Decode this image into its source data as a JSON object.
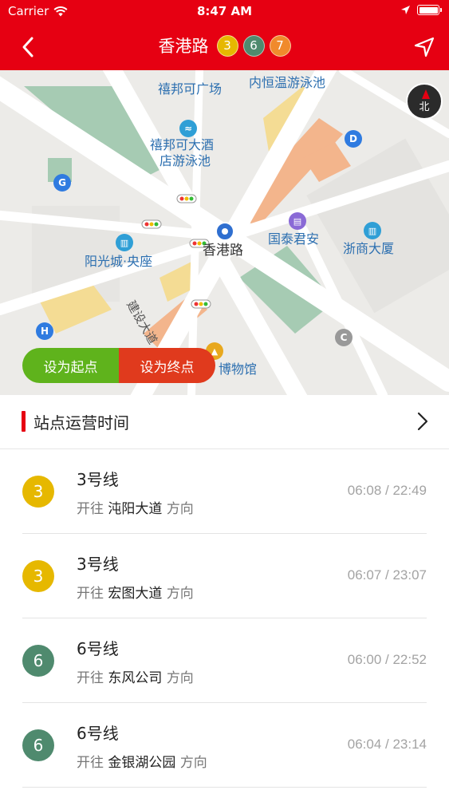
{
  "status_bar": {
    "carrier": "Carrier",
    "time": "8:47 AM"
  },
  "nav": {
    "back_icon": "chevron-left-icon",
    "title": "香港路",
    "badges": [
      {
        "label": "3",
        "color": "#e6b800"
      },
      {
        "label": "6",
        "color": "#4f8a6e"
      },
      {
        "label": "7",
        "color": "#f08a2c"
      }
    ],
    "navigate_icon": "navigation-arrow-icon"
  },
  "map": {
    "labels": {
      "yixinwen": "禧邦可广场",
      "pool_top": "内恒温游泳池",
      "hotel_pool_1": "禧邦可大酒",
      "hotel_pool_2": "店游泳池",
      "yangguang": "阳光城·央座",
      "station": "香港路",
      "guotai": "国泰君安",
      "zheshang": "浙商大厦",
      "museum": "博物馆",
      "road": "建设大道"
    },
    "compass_label": "北",
    "set_start_label": "设为起点",
    "set_end_label": "设为终点",
    "colors": {
      "background": "#ecebe8",
      "road": "#ffffff",
      "green": "#9bc4a8",
      "yellow": "#f4dc94",
      "orange": "#f3b58c"
    }
  },
  "section": {
    "title": "站点运营时间",
    "chevron_icon": "chevron-right-icon"
  },
  "lines": [
    {
      "number": "3",
      "name": "3号线",
      "prefix": "开往",
      "destination": "沌阳大道",
      "suffix": "方向",
      "times": "06:08 / 22:49",
      "color": "#e6b800"
    },
    {
      "number": "3",
      "name": "3号线",
      "prefix": "开往",
      "destination": "宏图大道",
      "suffix": "方向",
      "times": "06:07 / 23:07",
      "color": "#e6b800"
    },
    {
      "number": "6",
      "name": "6号线",
      "prefix": "开往",
      "destination": "东风公司",
      "suffix": "方向",
      "times": "06:00 / 22:52",
      "color": "#4f8a6e"
    },
    {
      "number": "6",
      "name": "6号线",
      "prefix": "开往",
      "destination": "金银湖公园",
      "suffix": "方向",
      "times": "06:04 / 23:14",
      "color": "#4f8a6e"
    }
  ]
}
